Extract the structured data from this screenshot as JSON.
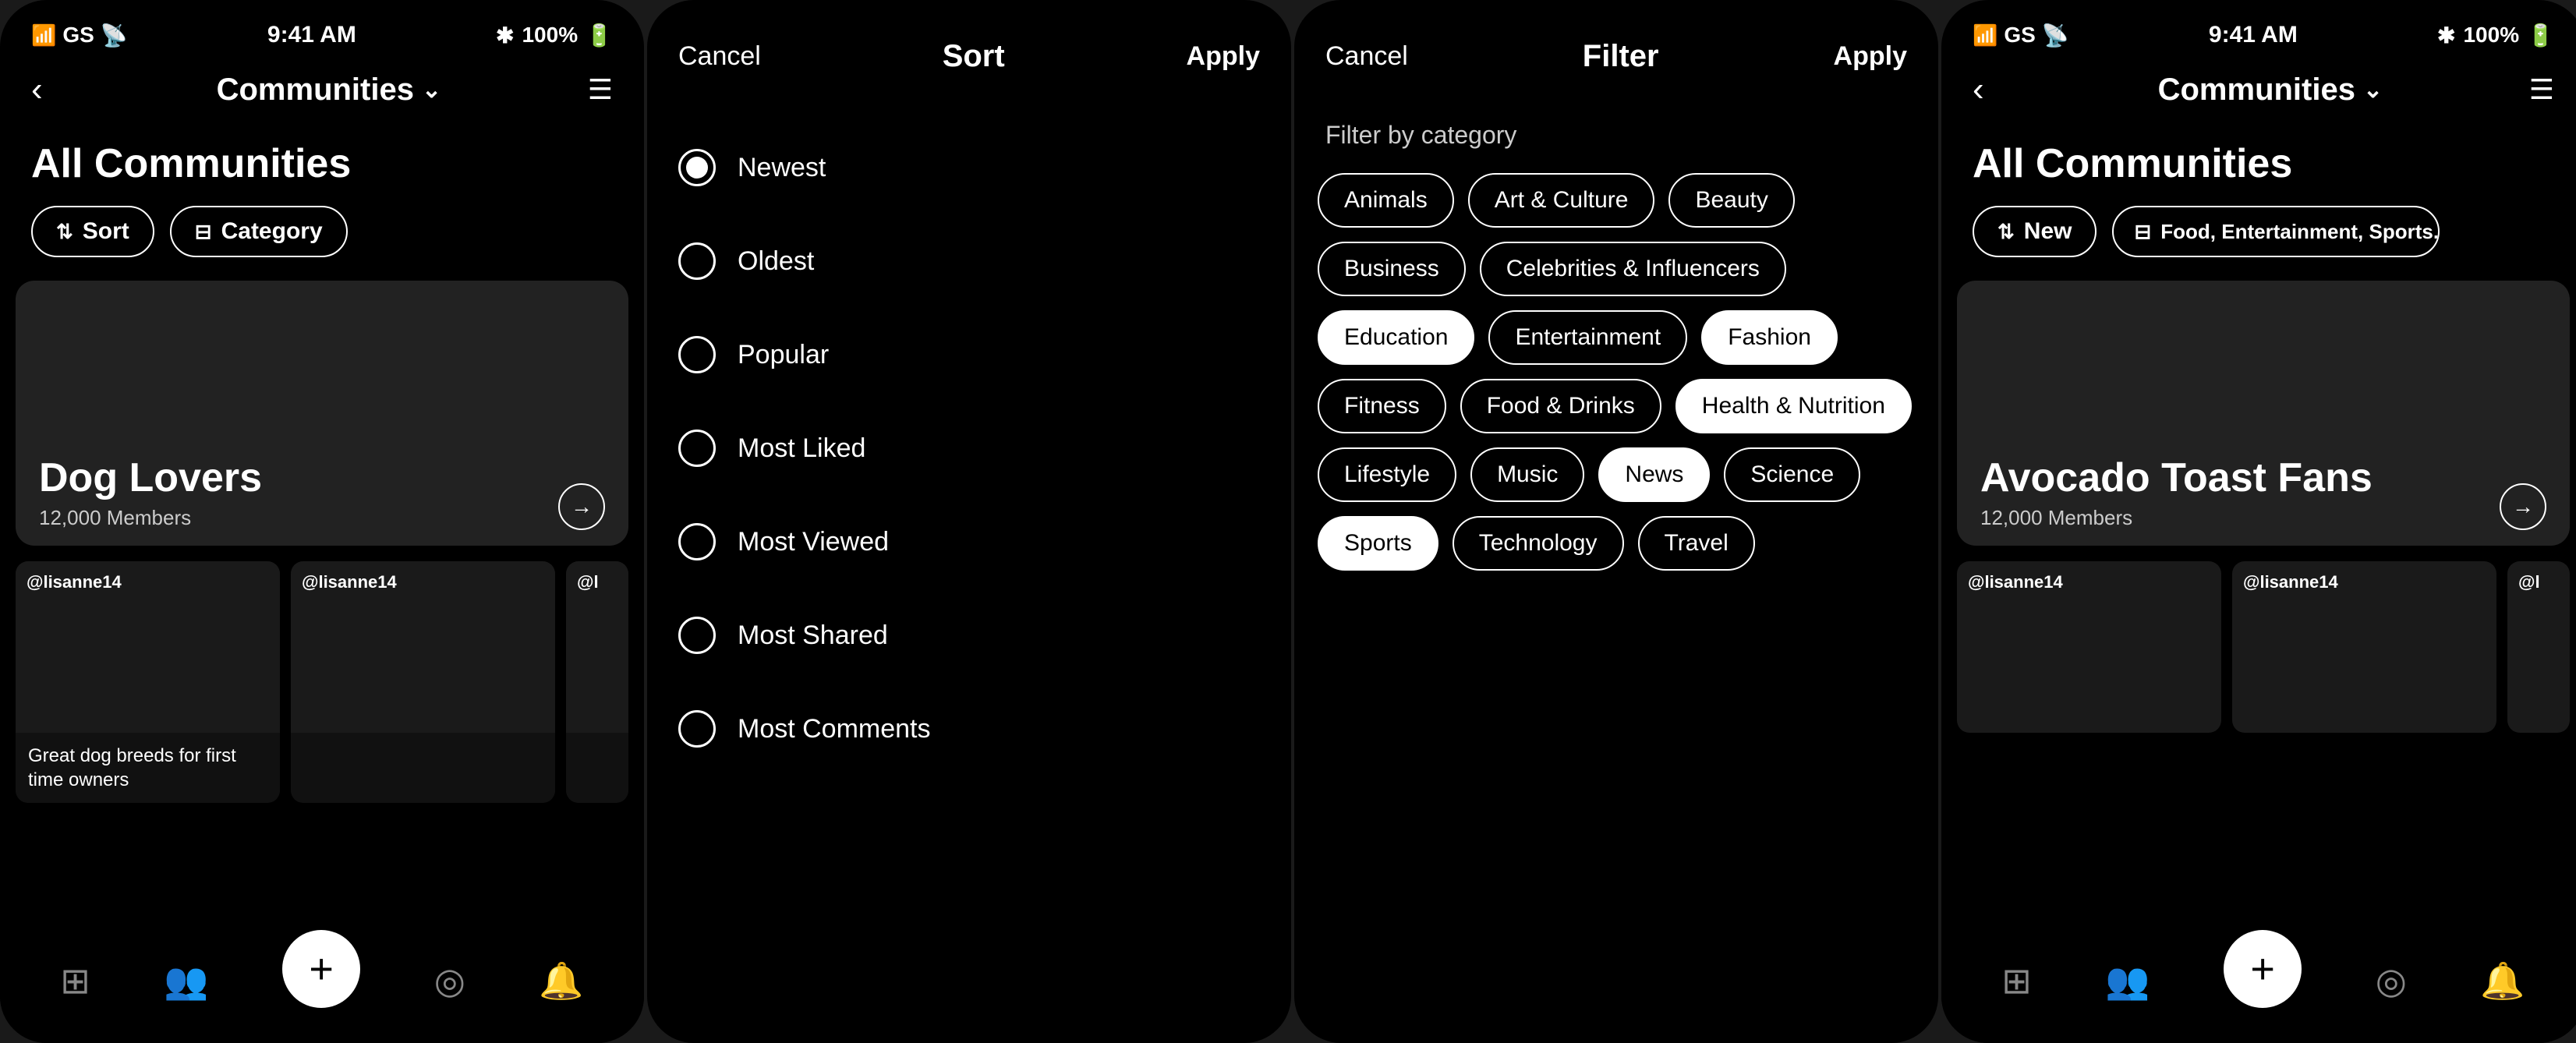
{
  "screens": [
    {
      "id": "communities-main",
      "statusBar": {
        "left": "GS",
        "time": "9:41 AM",
        "right": "100%"
      },
      "nav": {
        "backLabel": "‹",
        "title": "Communities",
        "chevron": "⌄",
        "menuIcon": "☰"
      },
      "pageTitle": "All Communities",
      "actionButtons": [
        {
          "icon": "sort",
          "label": "Sort"
        },
        {
          "icon": "filter",
          "label": "Category"
        }
      ],
      "communityCard": {
        "name": "Dog Lovers",
        "members": "12,000 Members",
        "arrowIcon": "→"
      },
      "posts": [
        {
          "user": "@lisanne14",
          "caption": "Great dog breeds for first time owners"
        },
        {
          "user": "@lisanne14",
          "caption": ""
        },
        {
          "user": "@l",
          "caption": ""
        }
      ],
      "bottomBar": {
        "icons": [
          "grid",
          "people",
          "plus",
          "compass",
          "bell"
        ],
        "fabLabel": "+"
      }
    },
    {
      "id": "sort-panel",
      "header": {
        "cancelLabel": "Cancel",
        "title": "Sort",
        "applyLabel": "Apply"
      },
      "options": [
        {
          "label": "Newest",
          "selected": true
        },
        {
          "label": "Oldest",
          "selected": false
        },
        {
          "label": "Popular",
          "selected": false
        },
        {
          "label": "Most Liked",
          "selected": false
        },
        {
          "label": "Most Viewed",
          "selected": false
        },
        {
          "label": "Most Shared",
          "selected": false
        },
        {
          "label": "Most Comments",
          "selected": false
        }
      ]
    },
    {
      "id": "filter-panel",
      "header": {
        "cancelLabel": "Cancel",
        "title": "Filter",
        "applyLabel": "Apply"
      },
      "sectionTitle": "Filter by category",
      "tags": [
        {
          "label": "Animals",
          "active": false
        },
        {
          "label": "Art & Culture",
          "active": false
        },
        {
          "label": "Beauty",
          "active": false
        },
        {
          "label": "Business",
          "active": false
        },
        {
          "label": "Celebrities & Influencers",
          "active": false
        },
        {
          "label": "Education",
          "active": true
        },
        {
          "label": "Entertainment",
          "active": false
        },
        {
          "label": "Fashion",
          "active": true
        },
        {
          "label": "Fitness",
          "active": false
        },
        {
          "label": "Food & Drinks",
          "active": false
        },
        {
          "label": "Health & Nutrition",
          "active": true
        },
        {
          "label": "Lifestyle",
          "active": false
        },
        {
          "label": "Music",
          "active": false
        },
        {
          "label": "News",
          "active": true
        },
        {
          "label": "Science",
          "active": false
        },
        {
          "label": "Sports",
          "active": true
        },
        {
          "label": "Technology",
          "active": false
        },
        {
          "label": "Travel",
          "active": false
        }
      ]
    },
    {
      "id": "communities-filtered",
      "statusBar": {
        "left": "GS",
        "time": "9:41 AM",
        "right": "100%"
      },
      "nav": {
        "backLabel": "‹",
        "title": "Communities",
        "chevron": "⌄",
        "menuIcon": "☰"
      },
      "pageTitle": "All Communities",
      "actionButtons": [
        {
          "icon": "sort",
          "label": "New"
        },
        {
          "icon": "filter",
          "label": "Food, Entertainment, Sports..."
        }
      ],
      "communityCard": {
        "name": "Avocado Toast Fans",
        "members": "12,000 Members",
        "arrowIcon": "→"
      },
      "posts": [
        {
          "user": "@lisanne14",
          "caption": ""
        },
        {
          "user": "@lisanne14",
          "caption": ""
        },
        {
          "user": "@l",
          "caption": ""
        }
      ],
      "bottomBar": {
        "icons": [
          "grid",
          "people",
          "plus",
          "compass",
          "bell"
        ],
        "fabLabel": "+"
      }
    }
  ]
}
